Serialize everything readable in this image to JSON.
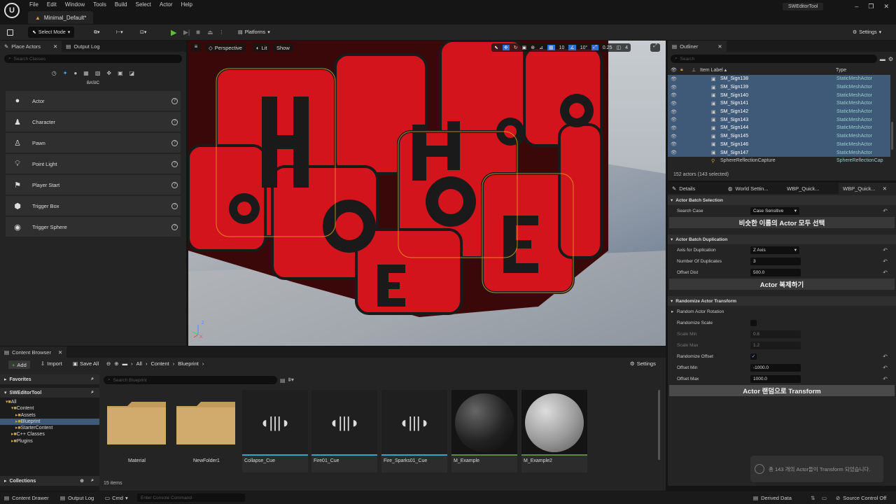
{
  "menu": [
    "File",
    "Edit",
    "Window",
    "Tools",
    "Build",
    "Select",
    "Actor",
    "Help"
  ],
  "project_tab": "Minimal_Default*",
  "app_name": "SWEditorTool",
  "toolbar": {
    "select_mode": "Select Mode",
    "platforms": "Platforms",
    "settings": "Settings"
  },
  "place_actors": {
    "tab": "Place Actors",
    "output_tab": "Output Log",
    "search_placeholder": "Search Classes",
    "category": "BASIC",
    "items": [
      {
        "label": "Actor",
        "icon": "actor-sphere-icon"
      },
      {
        "label": "Character",
        "icon": "character-icon"
      },
      {
        "label": "Pawn",
        "icon": "pawn-icon"
      },
      {
        "label": "Point Light",
        "icon": "point-light-icon"
      },
      {
        "label": "Player Start",
        "icon": "player-start-icon"
      },
      {
        "label": "Trigger Box",
        "icon": "trigger-box-icon"
      },
      {
        "label": "Trigger Sphere",
        "icon": "trigger-sphere-icon"
      }
    ]
  },
  "viewport": {
    "perspective": "Perspective",
    "lit": "Lit",
    "show": "Show",
    "grid": "10",
    "angle": "10°",
    "scale": "0.25",
    "camera": "4"
  },
  "outliner": {
    "tab": "Outliner",
    "search_placeholder": "Search",
    "col_label": "Item Label",
    "col_type": "Type",
    "rows": [
      {
        "label": "SM_Sign138",
        "type": "StaticMeshActor"
      },
      {
        "label": "SM_Sign139",
        "type": "StaticMeshActor"
      },
      {
        "label": "SM_Sign140",
        "type": "StaticMeshActor"
      },
      {
        "label": "SM_Sign141",
        "type": "StaticMeshActor"
      },
      {
        "label": "SM_Sign142",
        "type": "StaticMeshActor"
      },
      {
        "label": "SM_Sign143",
        "type": "StaticMeshActor"
      },
      {
        "label": "SM_Sign144",
        "type": "StaticMeshActor"
      },
      {
        "label": "SM_Sign145",
        "type": "StaticMeshActor"
      },
      {
        "label": "SM_Sign146",
        "type": "StaticMeshActor"
      },
      {
        "label": "SM_Sign147",
        "type": "StaticMeshActor"
      }
    ],
    "last_row": {
      "label": "SphereReflectionCapture",
      "type": "SphereReflectionCap"
    },
    "footer": "152 actors (143 selected)"
  },
  "details": {
    "tabs": [
      "Details",
      "World Settin...",
      "WBP_Quick...",
      "WBP_Quick..."
    ],
    "sec1": "Actor Batch Selection",
    "search_case_label": "Search Case",
    "search_case_value": "Case Sensitive",
    "btn_select": "비슷한 이름의 Actor 모두 선택",
    "sec2": "Actor Batch Duplication",
    "axis_label": "Axis for Duplication",
    "axis_value": "Z Axis",
    "num_label": "Number Of Duplicates",
    "num_value": "3",
    "offset_label": "Offset Dist",
    "offset_value": "500.0",
    "btn_duplicate": "Actor 복제하기",
    "sec3": "Randomize Actor Transform",
    "rand_rot": "Random Actor Rotation",
    "rand_scale": "Randomize Scale",
    "scale_min_label": "Scale Min",
    "scale_min_value": "0.8",
    "scale_max_label": "Scale Max",
    "scale_max_value": "1.2",
    "rand_offset": "Randomize Offset",
    "off_min_label": "Offset Min",
    "off_min_value": "-1000.0",
    "off_max_label": "Offset Max",
    "off_max_value": "1000.0",
    "btn_transform": "Actor 랜덤으로 Transform",
    "toast": "총 143 개의 Actor들이 Transform 되었습니다."
  },
  "content_browser": {
    "tab": "Content Browser",
    "add": "Add",
    "import": "Import",
    "save_all": "Save All",
    "path": [
      "All",
      "Content",
      "Blueprint"
    ],
    "settings": "Settings",
    "favorites": "Favorites",
    "project": "SWEditorTool",
    "tree": [
      "All",
      "Content",
      "Assets",
      "Blueprint",
      "StarterContent",
      "C++ Classes",
      "Plugins"
    ],
    "search_placeholder": "Search Blueprint",
    "collections": "Collections",
    "items_count": "15 items",
    "tiles": [
      {
        "label": "Material",
        "kind": "folder"
      },
      {
        "label": "NewFolder1",
        "kind": "folder"
      },
      {
        "label": "Collapse_Cue",
        "kind": "sound"
      },
      {
        "label": "Fire01_Cue",
        "kind": "sound"
      },
      {
        "label": "Fire_Sparks01_Cue",
        "kind": "sound"
      },
      {
        "label": "M_Example",
        "kind": "material-dark"
      },
      {
        "label": "M_Example2",
        "kind": "material-grid"
      }
    ]
  },
  "status": {
    "content_drawer": "Content Drawer",
    "output_log": "Output Log",
    "cmd": "Cmd",
    "console_placeholder": "Enter Console Command",
    "derived_data": "Derived Data",
    "source_control": "Source Control Off"
  }
}
